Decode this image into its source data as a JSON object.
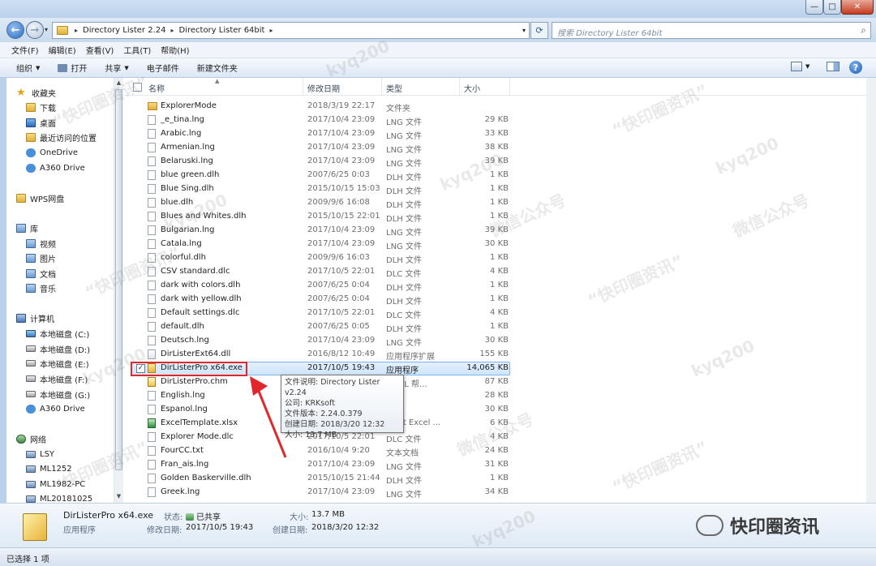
{
  "window": {
    "min_glyph": "—",
    "max_glyph": "□",
    "close_glyph": "✕"
  },
  "address": {
    "crumbs": [
      "Directory Lister 2.24",
      "Directory Lister 64bit"
    ],
    "sep": "▸"
  },
  "search": {
    "placeholder": "搜索 Directory Lister 64bit"
  },
  "menu": [
    "文件(F)",
    "编辑(E)",
    "查看(V)",
    "工具(T)",
    "帮助(H)"
  ],
  "toolbar": {
    "organize": "组织",
    "open": "打开",
    "share": "共享",
    "email": "电子邮件",
    "new_folder": "新建文件夹",
    "help": "?"
  },
  "nav": {
    "favorites": "收藏夹",
    "downloads": "下载",
    "desktop": "桌面",
    "recent": "最近访问的位置",
    "onedrive": "OneDrive",
    "a360_fav": "A360 Drive",
    "wps": "WPS网盘",
    "libraries": "库",
    "videos": "视频",
    "pictures": "图片",
    "documents": "文档",
    "music": "音乐",
    "computer": "计算机",
    "drive_c": "本地磁盘 (C:)",
    "drive_d": "本地磁盘 (D:)",
    "drive_e": "本地磁盘 (E:)",
    "drive_f": "本地磁盘 (F:)",
    "drive_g": "本地磁盘 (G:)",
    "a360": "A360 Drive",
    "network": "网络",
    "lsy": "LSY",
    "ml1252": "ML1252",
    "ml1982": "ML1982-PC",
    "ml2018": "ML20181025"
  },
  "columns": {
    "name": "名称",
    "date": "修改日期",
    "type": "类型",
    "size": "大小"
  },
  "files": [
    {
      "name": "ExplorerMode",
      "date": "2018/3/19 22:17",
      "type": "文件夹",
      "size": "",
      "kind": "folder"
    },
    {
      "name": "_e_tina.lng",
      "date": "2017/10/4 23:09",
      "type": "LNG 文件",
      "size": "29 KB",
      "kind": "file"
    },
    {
      "name": "Arabic.lng",
      "date": "2017/10/4 23:09",
      "type": "LNG 文件",
      "size": "33 KB",
      "kind": "file"
    },
    {
      "name": "Armenian.lng",
      "date": "2017/10/4 23:09",
      "type": "LNG 文件",
      "size": "38 KB",
      "kind": "file"
    },
    {
      "name": "Belaruski.lng",
      "date": "2017/10/4 23:09",
      "type": "LNG 文件",
      "size": "39 KB",
      "kind": "file"
    },
    {
      "name": "blue green.dlh",
      "date": "2007/6/25 0:03",
      "type": "DLH 文件",
      "size": "1 KB",
      "kind": "file"
    },
    {
      "name": "Blue Sing.dlh",
      "date": "2015/10/15 15:03",
      "type": "DLH 文件",
      "size": "1 KB",
      "kind": "file"
    },
    {
      "name": "blue.dlh",
      "date": "2009/9/6 16:08",
      "type": "DLH 文件",
      "size": "1 KB",
      "kind": "file"
    },
    {
      "name": "Blues and Whites.dlh",
      "date": "2015/10/15 22:01",
      "type": "DLH 文件",
      "size": "1 KB",
      "kind": "file"
    },
    {
      "name": "Bulgarian.lng",
      "date": "2017/10/4 23:09",
      "type": "LNG 文件",
      "size": "39 KB",
      "kind": "file"
    },
    {
      "name": "Catala.lng",
      "date": "2017/10/4 23:09",
      "type": "LNG 文件",
      "size": "30 KB",
      "kind": "file"
    },
    {
      "name": "colorful.dlh",
      "date": "2009/9/6 16:03",
      "type": "DLH 文件",
      "size": "1 KB",
      "kind": "file"
    },
    {
      "name": "CSV standard.dlc",
      "date": "2017/10/5 22:01",
      "type": "DLC 文件",
      "size": "4 KB",
      "kind": "file"
    },
    {
      "name": "dark with colors.dlh",
      "date": "2007/6/25 0:04",
      "type": "DLH 文件",
      "size": "1 KB",
      "kind": "file"
    },
    {
      "name": "dark with yellow.dlh",
      "date": "2007/6/25 0:04",
      "type": "DLH 文件",
      "size": "1 KB",
      "kind": "file"
    },
    {
      "name": "Default settings.dlc",
      "date": "2017/10/5 22:01",
      "type": "DLC 文件",
      "size": "4 KB",
      "kind": "file"
    },
    {
      "name": "default.dlh",
      "date": "2007/6/25 0:05",
      "type": "DLH 文件",
      "size": "1 KB",
      "kind": "file"
    },
    {
      "name": "Deutsch.lng",
      "date": "2017/10/4 23:09",
      "type": "LNG 文件",
      "size": "30 KB",
      "kind": "file"
    },
    {
      "name": "DirListerExt64.dll",
      "date": "2016/8/12 10:49",
      "type": "应用程序扩展",
      "size": "155 KB",
      "kind": "dll"
    },
    {
      "name": "DirListerPro x64.exe",
      "date": "2017/10/5 19:43",
      "type": "应用程序",
      "size": "14,065 KB",
      "kind": "exe",
      "selected": true
    },
    {
      "name": "DirListerPro.chm",
      "date": "",
      "type": "HTML 帮...",
      "size": "87 KB",
      "kind": "chm"
    },
    {
      "name": "English.lng",
      "date": "",
      "type": "文件",
      "size": "28 KB",
      "kind": "file"
    },
    {
      "name": "Espanol.lng",
      "date": "",
      "type": "文件",
      "size": "30 KB",
      "kind": "file"
    },
    {
      "name": "ExcelTemplate.xlsx",
      "date": "",
      "type": "osoft Excel ...",
      "size": "6 KB",
      "kind": "xlsx"
    },
    {
      "name": "Explorer Mode.dlc",
      "date": "2017/10/5 22:01",
      "type": "DLC 文件",
      "size": "4 KB",
      "kind": "file"
    },
    {
      "name": "FourCC.txt",
      "date": "2016/10/4 9:20",
      "type": "文本文档",
      "size": "24 KB",
      "kind": "txt"
    },
    {
      "name": "Fran_ais.lng",
      "date": "2017/10/4 23:09",
      "type": "LNG 文件",
      "size": "31 KB",
      "kind": "file"
    },
    {
      "name": "Golden Baskerville.dlh",
      "date": "2015/10/15 21:44",
      "type": "DLH 文件",
      "size": "1 KB",
      "kind": "file"
    },
    {
      "name": "Greek.lng",
      "date": "2017/10/4 23:09",
      "type": "LNG 文件",
      "size": "34 KB",
      "kind": "file"
    }
  ],
  "tooltip": {
    "desc": "文件说明: Directory Lister v2.24",
    "company": "公司: KRKsoft",
    "version": "文件版本: 2.24.0.379",
    "created": "创建日期: 2018/3/20 12:32",
    "size": "大小: 13.7 MB"
  },
  "details": {
    "filename": "DirListerPro x64.exe",
    "filetype": "应用程序",
    "status_label": "状态:",
    "status_value": "已共享",
    "size_label": "大小:",
    "size_value": "13.7 MB",
    "modified_label": "修改日期:",
    "modified_value": "2017/10/5 19:43",
    "created_label": "创建日期:",
    "created_value": "2018/3/20 12:32"
  },
  "statusbar": {
    "text": "已选择 1 项"
  },
  "watermark": {
    "logo_text": "快印圈资讯",
    "mark1": "kyq200",
    "mark2": "“快印圈资讯”",
    "mark3": "微信公众号"
  },
  "colors": {
    "selection": "#cfe4fb",
    "highlight_box": "#e0282c",
    "arrow": "#e0282c"
  }
}
